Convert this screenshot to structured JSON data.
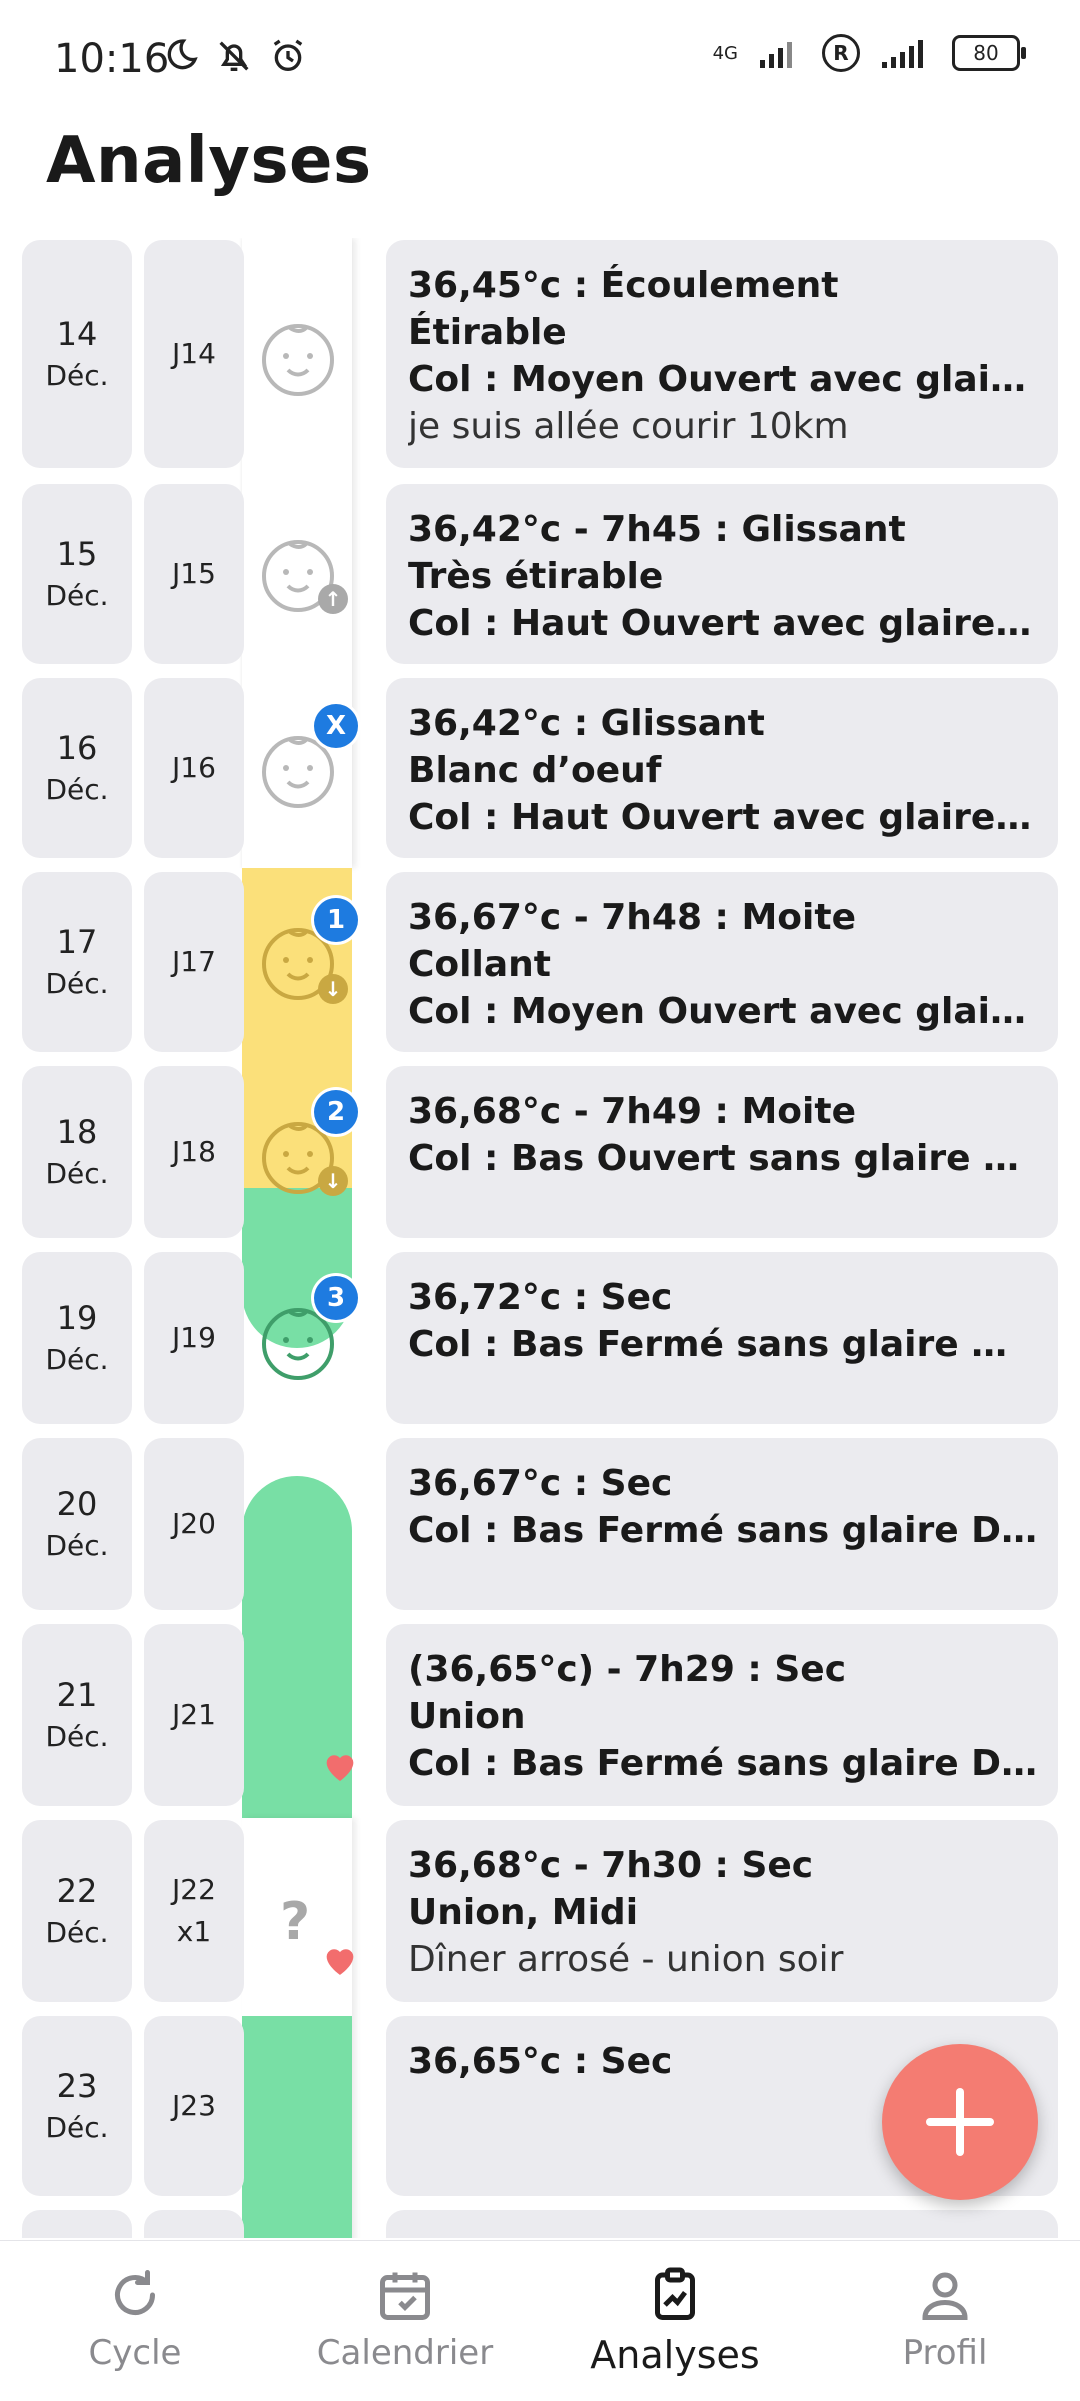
{
  "status_bar": {
    "time": "10:16",
    "network": "4G",
    "roaming": "R",
    "battery": "80"
  },
  "header": {
    "title": "Analyses"
  },
  "entries": [
    {
      "day": "14",
      "month": "Déc.",
      "jday": "J14",
      "lines": [
        "36,45°c : Écoulement",
        "Étirable",
        "Col : Moyen Ouvert avec glaire …"
      ],
      "note": "je suis allée courir 10km"
    },
    {
      "day": "15",
      "month": "Déc.",
      "jday": "J15",
      "lines": [
        "36,42°c - 7h45 : Glissant",
        "Très étirable",
        "Col : Haut Ouvert avec glaire Mou"
      ],
      "note": ""
    },
    {
      "day": "16",
      "month": "Déc.",
      "jday": "J16",
      "badge": "X",
      "lines": [
        "36,42°c : Glissant",
        "Blanc d’oeuf",
        "Col : Haut Ouvert avec glaire Mou"
      ],
      "note": ""
    },
    {
      "day": "17",
      "month": "Déc.",
      "jday": "J17",
      "badge": "1",
      "lines": [
        "36,67°c - 7h48 : Moite",
        "Collant",
        "Col : Moyen Ouvert avec glaire …"
      ],
      "note": ""
    },
    {
      "day": "18",
      "month": "Déc.",
      "jday": "J18",
      "badge": "2",
      "lines": [
        "36,68°c - 7h49 : Moite",
        "Col : Bas Ouvert sans glaire Mou"
      ],
      "note": ""
    },
    {
      "day": "19",
      "month": "Déc.",
      "jday": "J19",
      "badge": "3",
      "lines": [
        "36,72°c : Sec",
        "Col : Bas Fermé sans glaire Mou"
      ],
      "note": ""
    },
    {
      "day": "20",
      "month": "Déc.",
      "jday": "J20",
      "lines": [
        "36,67°c : Sec",
        "Col : Bas Fermé sans glaire Dur"
      ],
      "note": ""
    },
    {
      "day": "21",
      "month": "Déc.",
      "jday": "J21",
      "lines": [
        "(36,65°c) - 7h29 : Sec",
        "Union",
        "Col : Bas Fermé sans glaire Dur"
      ],
      "note": ""
    },
    {
      "day": "22",
      "month": "Déc.",
      "jday": "J22",
      "jday_extra": "x1",
      "question": "?",
      "lines": [
        "36,68°c - 7h30 : Sec",
        "Union, Midi"
      ],
      "note": "Dîner arrosé - union soir"
    },
    {
      "day": "23",
      "month": "Déc.",
      "jday": "J23",
      "lines": [
        "36,65°c : Sec"
      ],
      "note": ""
    }
  ],
  "colors": {
    "fertile_yellow": "#fbe07a",
    "green": "#78dfa5",
    "badge_blue": "#1e7be0",
    "fab": "#f47c72",
    "heart": "#f26d6d"
  },
  "nav": {
    "cycle": "Cycle",
    "calendar": "Calendrier",
    "analyses": "Analyses",
    "profile": "Profil",
    "active": "Analyses"
  }
}
